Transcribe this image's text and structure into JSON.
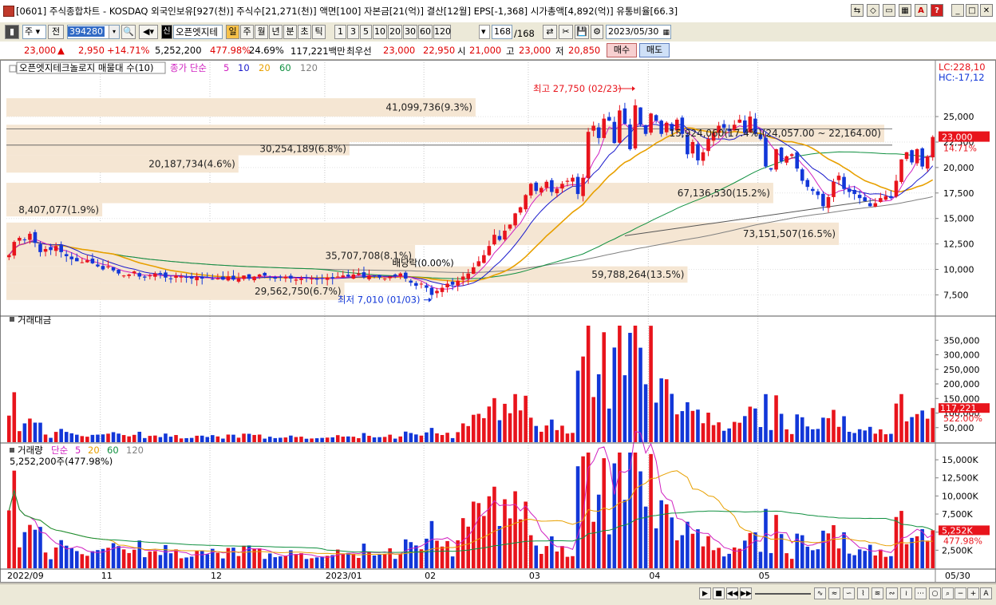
{
  "window": {
    "title": "[0601] 주식종합차트 - KOSDAQ 외국인보유[927(천)] 주식수[21,271(천)] 액면[100] 자본금[21(억)] 결산[12월] EPS[-1,368] 시가총액[4,892(억)] 유통비율[66.3]",
    "minimize_label": "_",
    "maximize_label": "□",
    "close_label": "✕"
  },
  "toolbar": {
    "period_select": "주",
    "period_prefix": "전",
    "stock_code": "394280",
    "stock_name": "오픈엣지테",
    "badge_new": "신",
    "intervals": [
      "일",
      "주",
      "월",
      "년",
      "분",
      "초",
      "틱"
    ],
    "intervals_active": "일",
    "numbers": [
      "1",
      "3",
      "5",
      "10",
      "20",
      "30",
      "60",
      "120"
    ],
    "count_value": "168",
    "count_total": "/168",
    "date": "2023/05/30"
  },
  "quote": {
    "price": "23,000",
    "arrow": "▲",
    "change": "2,950",
    "change_pct": "+14.71%",
    "volume": "5,252,200",
    "volume_ratio": "477.98%",
    "turnover": "24.69%",
    "trade_amount": "117,221백만",
    "pref_label": "최우선",
    "ask": "23,000",
    "bid": "22,950",
    "open_label": "시",
    "open": "21,000",
    "high_label": "고",
    "high": "23,000",
    "low_label": "저",
    "low": "20,850",
    "buy_label": "매수",
    "sell_label": "매도"
  },
  "colors": {
    "up": "#e8141c",
    "down": "#1237d8",
    "ma5": "#d020c0",
    "ma10": "#1a1acc",
    "ma20": "#e8a000",
    "ma60": "#109040",
    "ma120": "#808080",
    "band": "#f5e6d3"
  },
  "price_panel": {
    "legend_name": "오픈엣지테크놀로지 매물대 수(10)",
    "legend_ma": "종가 단순",
    "legend_periods": [
      "5",
      "10",
      "20",
      "60",
      "120"
    ],
    "lc": "LC:228,10",
    "hc": "HC:-17,12",
    "current_tag": "23,000",
    "current_pct": "14.71%",
    "max_label": "최고 27,750 (02/23)",
    "min_label": "최저 7,010 (01/03)",
    "dividend_label": "배당락(0.00%)"
  },
  "volume_profile": [
    {
      "label": "41,099,736(9.3%)"
    },
    {
      "label": "15,924,060(17.4%)(24,057.00 ~ 22,164.00)"
    },
    {
      "label": "30,254,189(6.8%)"
    },
    {
      "label": "20,187,734(4.6%)"
    },
    {
      "label": "67,136,530(15.2%)"
    },
    {
      "label": "8,407,077(1.9%)"
    },
    {
      "label": "73,151,507(16.5%)"
    },
    {
      "label": "35,707,708(8.1%)"
    },
    {
      "label": "59,788,264(13.5%)"
    },
    {
      "label": "29,562,750(6.7%)"
    }
  ],
  "amount_panel": {
    "title": "거래대금",
    "last_tag": "117,221",
    "last_pct": "522.00%"
  },
  "volume_panel": {
    "title": "거래량",
    "legend_ma": "단순",
    "legend_periods": [
      "5",
      "20",
      "60",
      "120"
    ],
    "value_label": "5,252,200주(477.98%)",
    "last_tag": "5,252K",
    "last_pct": "477.98%"
  },
  "x_axis": {
    "labels": [
      "2022/09",
      "11",
      "12",
      "2023/01",
      "02",
      "03",
      "04",
      "05"
    ],
    "right_label": "05/30"
  },
  "chart_data": [
    {
      "type": "candlestick",
      "title": "오픈엣지테크놀로지",
      "ylim": [
        5500,
        29000
      ],
      "yticks": [
        7500,
        10000,
        12500,
        15000,
        17500,
        20000,
        22500,
        25000
      ],
      "ytick_labels": [
        "7,500",
        "10,000",
        "12,500",
        "15,000",
        "17,500",
        "20,000",
        "22,500",
        "25,000"
      ],
      "close": [
        11400,
        12700,
        13100,
        12900,
        13500,
        12600,
        11700,
        12000,
        11900,
        12300,
        11700,
        11300,
        11000,
        10800,
        10700,
        10900,
        10600,
        10300,
        10000,
        10300,
        9900,
        9600,
        9400,
        9500,
        9800,
        9300,
        9200,
        9400,
        9600,
        9500,
        9200,
        9100,
        9400,
        9300,
        9200,
        9100,
        9300,
        9100,
        9200,
        9000,
        9100,
        9000,
        9300,
        9000,
        9100,
        9400,
        9100,
        9300,
        9500,
        9400,
        9200,
        9100,
        9200,
        9300,
        9100,
        9000,
        9100,
        9200,
        9100,
        9000,
        9100,
        9200,
        9100,
        9300,
        9400,
        9300,
        9500,
        9600,
        9200,
        9400,
        9300,
        9200,
        9100,
        9300,
        9400,
        9600,
        9100,
        8700,
        8400,
        8600,
        8200,
        7500,
        7900,
        8200,
        8600,
        8500,
        8900,
        9300,
        9600,
        10200,
        10800,
        11400,
        12300,
        13400,
        12900,
        13800,
        14400,
        15500,
        16100,
        17300,
        18400,
        17700,
        18000,
        18600,
        17600,
        17900,
        18400,
        18700,
        19000,
        17400,
        19000,
        23500,
        24100,
        22900,
        24800,
        24600,
        22400,
        25600,
        24300,
        21800,
        26100,
        24200,
        23300,
        25300,
        24600,
        23300,
        24400,
        23600,
        24700,
        23300,
        21300,
        22500,
        20700,
        21500,
        22800,
        23400,
        24100,
        23900,
        23600,
        24200,
        24700,
        23400,
        25000,
        23300,
        22800,
        20100,
        19800,
        21800,
        20600,
        21100,
        21300,
        19900,
        18700,
        18100,
        17700,
        17300,
        16200,
        17100,
        18600,
        19200,
        17900,
        17600,
        17400,
        17000,
        16700,
        16200,
        16500,
        17000,
        17200,
        17000,
        18700,
        20800,
        21500,
        20500,
        21800,
        20100,
        21100,
        23000
      ],
      "ma_lines": [
        "5",
        "10",
        "20",
        "60",
        "120"
      ]
    },
    {
      "type": "bar",
      "title": "거래대금",
      "ylim": [
        0,
        400000
      ],
      "yticks": [
        50000,
        100000,
        150000,
        200000,
        250000,
        300000,
        350000
      ],
      "ytick_labels": [
        "50,000",
        "100,000",
        "150,000",
        "200,000",
        "250,000",
        "300,000",
        "350,000"
      ],
      "last_value": 117221
    },
    {
      "type": "bar",
      "title": "거래량",
      "ylim": [
        0,
        16000
      ],
      "yticks": [
        2500,
        5000,
        7500,
        10000,
        12500,
        15000
      ],
      "ytick_labels": [
        "2,500K",
        "5,000K",
        "7,500K",
        "10,000K",
        "12,500K",
        "15,000K"
      ],
      "last_value": 5252
    }
  ]
}
